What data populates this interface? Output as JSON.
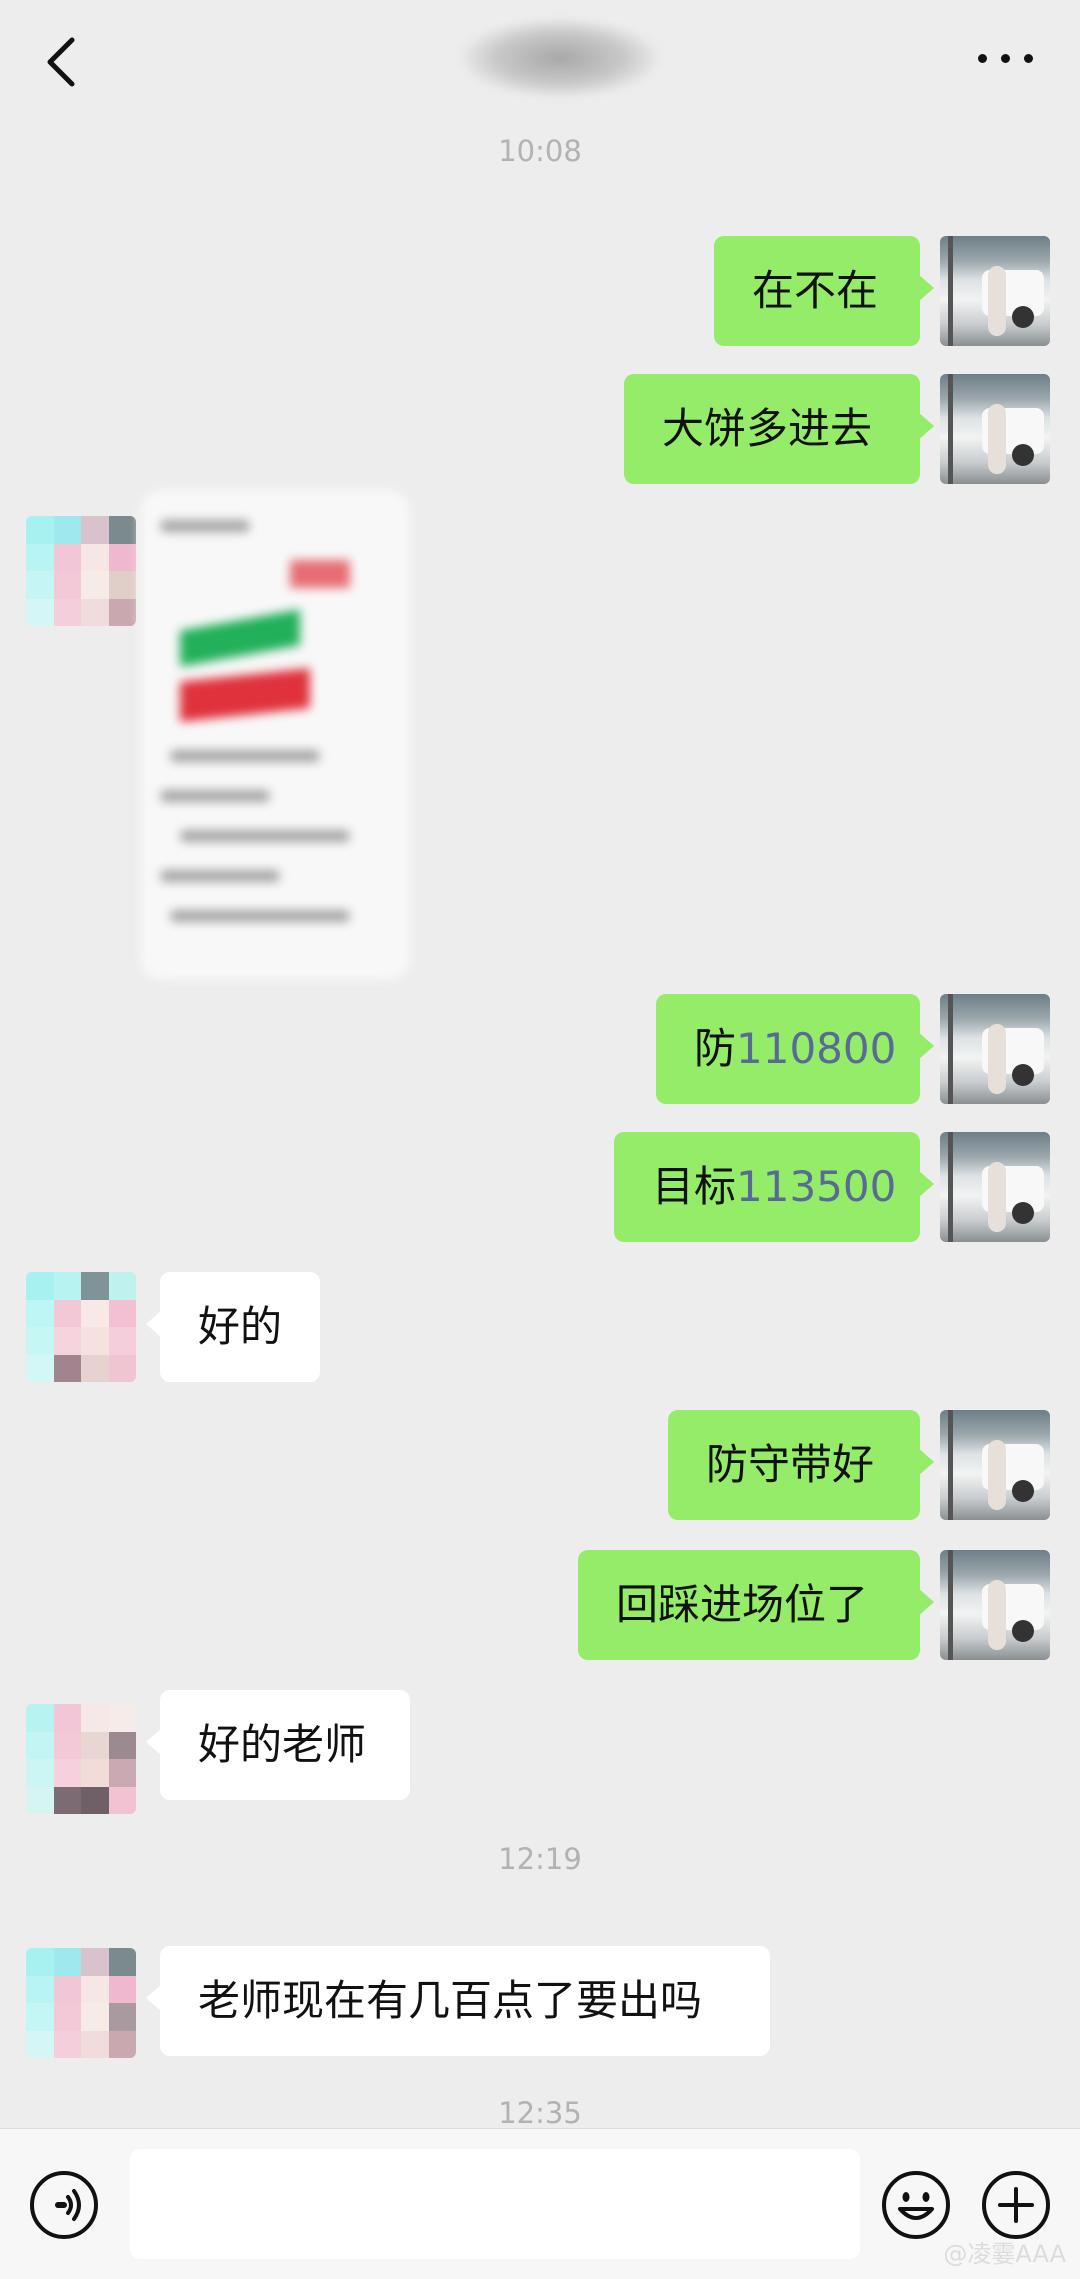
{
  "header": {
    "title": "",
    "back_icon": "chevron-left-icon",
    "more_icon": "more-horizontal-icon"
  },
  "timestamps": [
    "10:08",
    "12:19",
    "12:35"
  ],
  "messages": [
    {
      "side": "right",
      "text": "在不在"
    },
    {
      "side": "right",
      "text": "大饼多进去"
    },
    {
      "side": "left",
      "type": "image",
      "content": "blurred-screenshot"
    },
    {
      "side": "right",
      "prefix": "防",
      "number": "110800"
    },
    {
      "side": "right",
      "prefix": "目标",
      "number": "113500"
    },
    {
      "side": "left",
      "text": "好的"
    },
    {
      "side": "right",
      "text": "防守带好"
    },
    {
      "side": "right",
      "text": "回踩进场位了"
    },
    {
      "side": "left",
      "text": "好的老师"
    },
    {
      "side": "left",
      "text": "老师现在有几百点了要出吗"
    }
  ],
  "input_bar": {
    "voice_icon": "voice-icon",
    "input_value": "",
    "emoji_icon": "emoji-icon",
    "plus_icon": "plus-icon"
  },
  "watermark": "@凌霎AAA",
  "colors": {
    "background": "#ededed",
    "outgoing_bubble": "#95ec69",
    "incoming_bubble": "#ffffff",
    "number_link": "#576b95",
    "timestamp": "#b2b2b2"
  }
}
